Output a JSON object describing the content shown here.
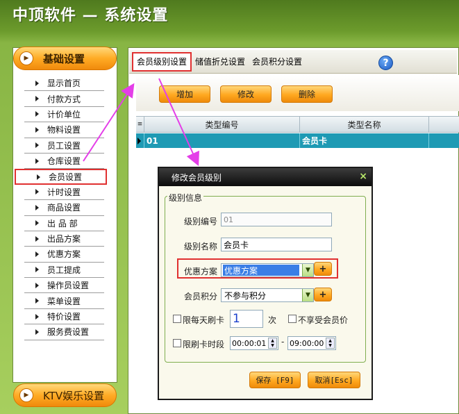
{
  "app": {
    "title": "中顶软件 — 系统设置"
  },
  "sidebar": {
    "top_category": "基础设置",
    "bottom_category": "KTV娱乐设置",
    "items": [
      {
        "label": "显示首页"
      },
      {
        "label": "付款方式"
      },
      {
        "label": "计价单位"
      },
      {
        "label": "物料设置"
      },
      {
        "label": "员工设置"
      },
      {
        "label": "仓库设置"
      },
      {
        "label": "会员设置"
      },
      {
        "label": "计时设置"
      },
      {
        "label": "商品设置"
      },
      {
        "label": "出 品 部"
      },
      {
        "label": "出品方案"
      },
      {
        "label": "优惠方案"
      },
      {
        "label": "员工提成"
      },
      {
        "label": "操作员设置"
      },
      {
        "label": "菜单设置"
      },
      {
        "label": "特价设置"
      },
      {
        "label": "服务费设置"
      }
    ],
    "selected": "会员设置"
  },
  "tabs": [
    {
      "label": "会员级别设置"
    },
    {
      "label": "储值折兑设置"
    },
    {
      "label": "会员积分设置"
    }
  ],
  "help_icon": "?",
  "toolbar": {
    "add": "增加",
    "edit": "修改",
    "delete": "删除"
  },
  "grid": {
    "marker": "≡",
    "columns": [
      "类型编号",
      "类型名称"
    ],
    "rows": [
      {
        "code": "01",
        "name": "会员卡"
      }
    ]
  },
  "dialog": {
    "title": "修改会员级别",
    "close": "×",
    "group": "级别信息",
    "level_code_label": "级别编号",
    "level_code_value": "01",
    "level_name_label": "级别名称",
    "level_name_value": "会员卡",
    "discount_label": "优惠方案",
    "discount_value": "优惠方案",
    "points_label": "会员积分",
    "points_value": "不参与积分",
    "plus": "+",
    "daily_limit_label": "限每天刷卡",
    "daily_limit_value": "1",
    "times_unit": "次",
    "no_member_price": "不享受会员价",
    "time_limit_label": "限刷卡时段",
    "time_from": "00:00:01",
    "time_sep": "-",
    "time_to": "09:00:00",
    "save": "保存 [F9]",
    "cancel": "取消[Esc]"
  },
  "colors": {
    "accent_red": "#e03030",
    "selected_row": "#1e9ab4",
    "arrow": "#e43ee8",
    "button_orange": "#ffa820"
  }
}
